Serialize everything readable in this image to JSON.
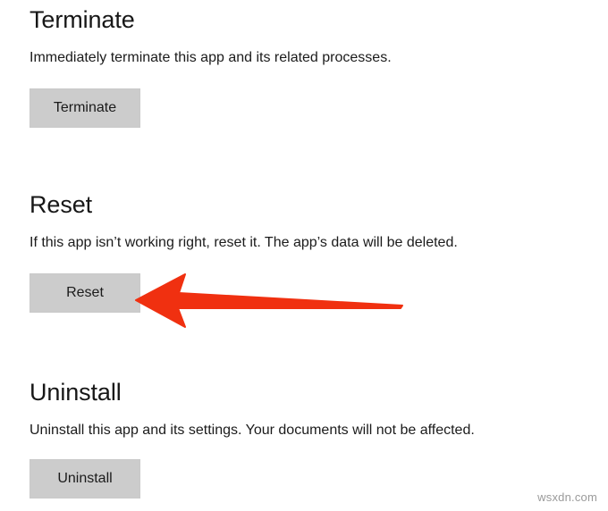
{
  "page": {
    "background_color": "#FFFFFF",
    "watermark": "wsxdn.com"
  },
  "theme": {
    "heading_color": "#171717",
    "body_text_color": "#1B1B1B",
    "button_fill": "#CCCCCC",
    "arrow_color": "#F03010",
    "watermark_color": "#9A9A9A"
  },
  "sections": [
    {
      "id": "terminate",
      "title": "Terminate",
      "description": "Immediately terminate this app and its related processes.",
      "button_label": "Terminate"
    },
    {
      "id": "reset",
      "title": "Reset",
      "description": "If this app isn’t working right, reset it. The app’s data will be deleted.",
      "button_label": "Reset"
    },
    {
      "id": "uninstall",
      "title": "Uninstall",
      "description": "Uninstall this app and its settings. Your documents will not be affected.",
      "button_label": "Uninstall"
    }
  ],
  "annotation": {
    "icon": "arrow-left-icon",
    "color": "#F03010",
    "points_to": "reset-button"
  }
}
